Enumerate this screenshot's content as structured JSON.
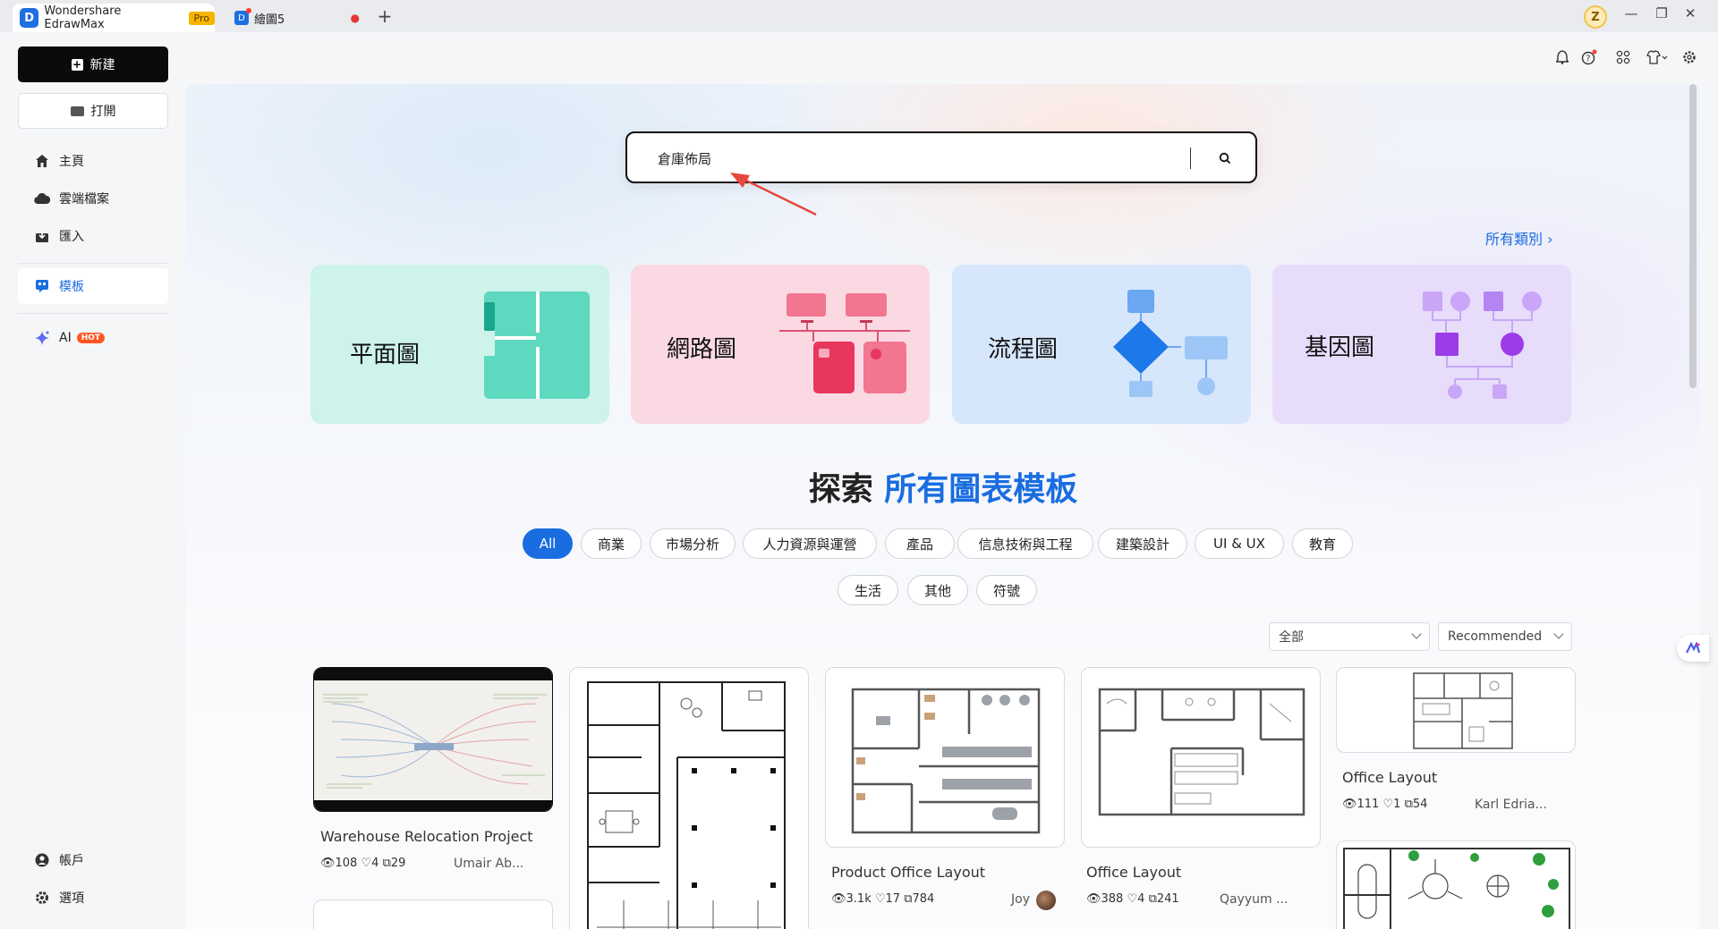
{
  "titlebar": {
    "app_tab_label": "Wondershare EdrawMax",
    "pro_label": "Pro",
    "drawing_tab_label": "繪圖5",
    "unsaved_marker": "●",
    "new_tab": "+",
    "user_initial": "Z",
    "minimize": "—",
    "restore": "❐",
    "close": "✕"
  },
  "sidebar": {
    "new_label": "新建",
    "open_label": "打開",
    "items": [
      {
        "label": "主頁",
        "icon": "home-icon"
      },
      {
        "label": "雲端檔案",
        "icon": "cloud-icon"
      },
      {
        "label": "匯入",
        "icon": "import-icon"
      },
      {
        "label": "模板",
        "icon": "template-icon"
      },
      {
        "label": "AI",
        "icon": "ai-sparkle-icon",
        "badge": "HOT"
      }
    ],
    "bottom_items": [
      {
        "label": "帳戶",
        "icon": "account-icon"
      },
      {
        "label": "選項",
        "icon": "settings-icon"
      }
    ]
  },
  "topbar_icons": [
    "bell-icon",
    "help-icon",
    "apps-icon",
    "shirt-theme-icon",
    "gear-icon"
  ],
  "search": {
    "value": "倉庫佈局",
    "placeholder": ""
  },
  "all_categories_label": "所有類別 ›",
  "category_cards": [
    {
      "label": "平面圖",
      "bg": "#cdf3ea"
    },
    {
      "label": "網路圖",
      "bg": "#fbd9e3"
    },
    {
      "label": "流程圖",
      "bg": "#d6e6fb"
    },
    {
      "label": "基因圖",
      "bg": "#e7dcfa"
    }
  ],
  "explore": {
    "prefix": "探索",
    "highlight": "所有圖表模板"
  },
  "chips_row1": [
    "All",
    "商業",
    "市場分析",
    "人力資源與運營",
    "產品",
    "信息技術與工程",
    "建築設計",
    "UI & UX",
    "教育"
  ],
  "chips_row2": [
    "生活",
    "其他",
    "符號"
  ],
  "filters": {
    "scope": "全部",
    "sort": "Recommended"
  },
  "templates": [
    {
      "title": "Warehouse Relocation Project",
      "views": "108",
      "likes": "4",
      "copies": "29",
      "author": "Umair Ab..."
    },
    {
      "title": "",
      "views": "",
      "likes": "",
      "copies": "",
      "author": ""
    },
    {
      "title": "Product Office Layout",
      "views": "3.1k",
      "likes": "17",
      "copies": "784",
      "author": "Joy"
    },
    {
      "title": "Office Layout",
      "views": "388",
      "likes": "4",
      "copies": "241",
      "author": "Qayyum ..."
    },
    {
      "title": "Office Layout",
      "views": "111",
      "likes": "1",
      "copies": "54",
      "author": "Karl Edria..."
    }
  ],
  "colors": {
    "accent": "#1a6de0",
    "hot": "#ff5722",
    "pro": "#f7b500"
  }
}
